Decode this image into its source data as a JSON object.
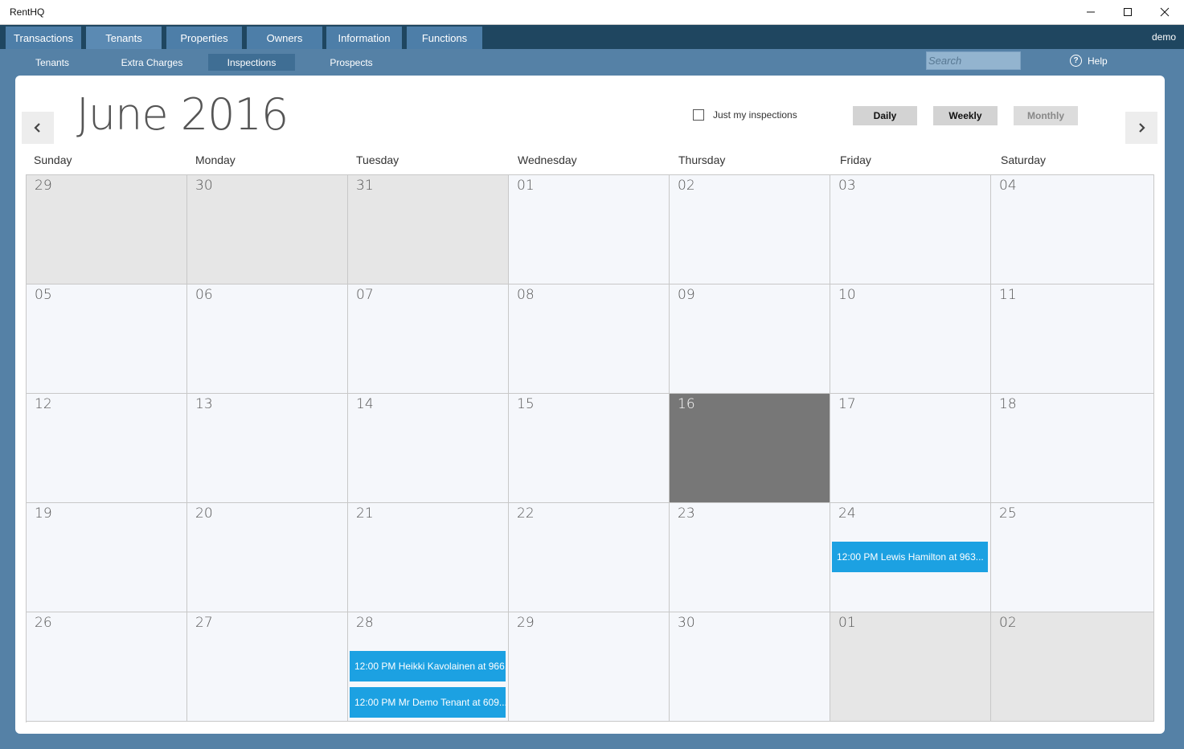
{
  "window": {
    "title": "RentHQ",
    "icons": [
      "minimize-icon",
      "maximize-icon",
      "close-icon"
    ]
  },
  "topnav": {
    "tabs": [
      {
        "label": "Transactions"
      },
      {
        "label": "Tenants",
        "active": true
      },
      {
        "label": "Properties"
      },
      {
        "label": "Owners"
      },
      {
        "label": "Information"
      },
      {
        "label": "Functions"
      }
    ],
    "user": "demo"
  },
  "subnav": {
    "tabs": [
      {
        "label": "Tenants"
      },
      {
        "label": "Extra Charges"
      },
      {
        "label": "Inspections",
        "active": true
      },
      {
        "label": "Prospects"
      }
    ],
    "search_placeholder": "Search",
    "help_label": "Help"
  },
  "calendar": {
    "month_title": "June 2016",
    "just_mine_label": "Just my inspections",
    "just_mine_checked": false,
    "views": {
      "daily": "Daily",
      "weekly": "Weekly",
      "monthly": "Monthly"
    },
    "active_view": "Monthly",
    "day_names": [
      "Sunday",
      "Monday",
      "Tuesday",
      "Wednesday",
      "Thursday",
      "Friday",
      "Saturday"
    ],
    "today": "16",
    "weeks": [
      [
        {
          "d": "29",
          "other": true
        },
        {
          "d": "30",
          "other": true
        },
        {
          "d": "31",
          "other": true
        },
        {
          "d": "01"
        },
        {
          "d": "02"
        },
        {
          "d": "03"
        },
        {
          "d": "04"
        }
      ],
      [
        {
          "d": "05"
        },
        {
          "d": "06"
        },
        {
          "d": "07"
        },
        {
          "d": "08"
        },
        {
          "d": "09"
        },
        {
          "d": "10"
        },
        {
          "d": "11"
        }
      ],
      [
        {
          "d": "12"
        },
        {
          "d": "13"
        },
        {
          "d": "14"
        },
        {
          "d": "15"
        },
        {
          "d": "16",
          "today": true
        },
        {
          "d": "17"
        },
        {
          "d": "18"
        }
      ],
      [
        {
          "d": "19"
        },
        {
          "d": "20"
        },
        {
          "d": "21"
        },
        {
          "d": "22"
        },
        {
          "d": "23"
        },
        {
          "d": "24",
          "events": [
            "12:00 PM Lewis Hamilton at 963..."
          ]
        },
        {
          "d": "25"
        }
      ],
      [
        {
          "d": "26"
        },
        {
          "d": "27"
        },
        {
          "d": "28",
          "events": [
            "12:00 PM Heikki Kavolainen at 966...",
            "12:00 PM Mr Demo Tenant at 609..."
          ]
        },
        {
          "d": "29"
        },
        {
          "d": "30"
        },
        {
          "d": "01",
          "other": true
        },
        {
          "d": "02",
          "other": true
        }
      ]
    ]
  }
}
